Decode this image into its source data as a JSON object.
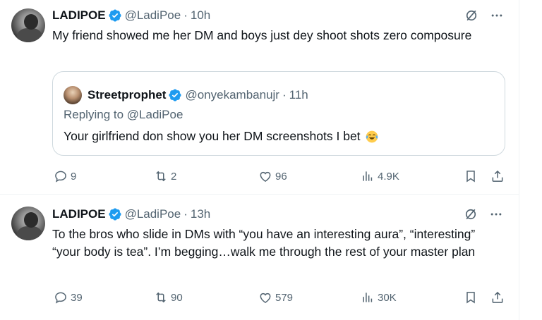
{
  "colors": {
    "text": "#0f1419",
    "muted": "#536471",
    "verified": "#1d9bf0",
    "border": "#cfd9de"
  },
  "tweets": [
    {
      "name": "LADIPOE",
      "handle": "@LadiPoe",
      "time": "10h",
      "text": "My friend showed me her DM and boys just dey shoot shots zero composure",
      "quote": {
        "name": "Streetprophet",
        "handle": "@onyekambanujr",
        "time": "11h",
        "replying_to": "Replying to @LadiPoe",
        "text": "Your girlfriend don show you her DM screenshots I bet",
        "emoji": "face-with-tears-of-joy"
      },
      "stats": {
        "replies": "9",
        "reposts": "2",
        "likes": "96",
        "views": "4.9K"
      }
    },
    {
      "name": "LADIPOE",
      "handle": "@LadiPoe",
      "time": "13h",
      "text": "To the bros who slide in DMs with “you have an interesting aura”, “interesting” “your body is tea”. I’m begging…walk me through the rest of your master plan",
      "stats": {
        "replies": "39",
        "reposts": "90",
        "likes": "579",
        "views": "30K"
      }
    }
  ],
  "icons": [
    "verified-badge-icon",
    "grok-icon",
    "more-icon",
    "reply-icon",
    "repost-icon",
    "like-icon",
    "views-icon",
    "bookmark-icon",
    "share-icon"
  ]
}
